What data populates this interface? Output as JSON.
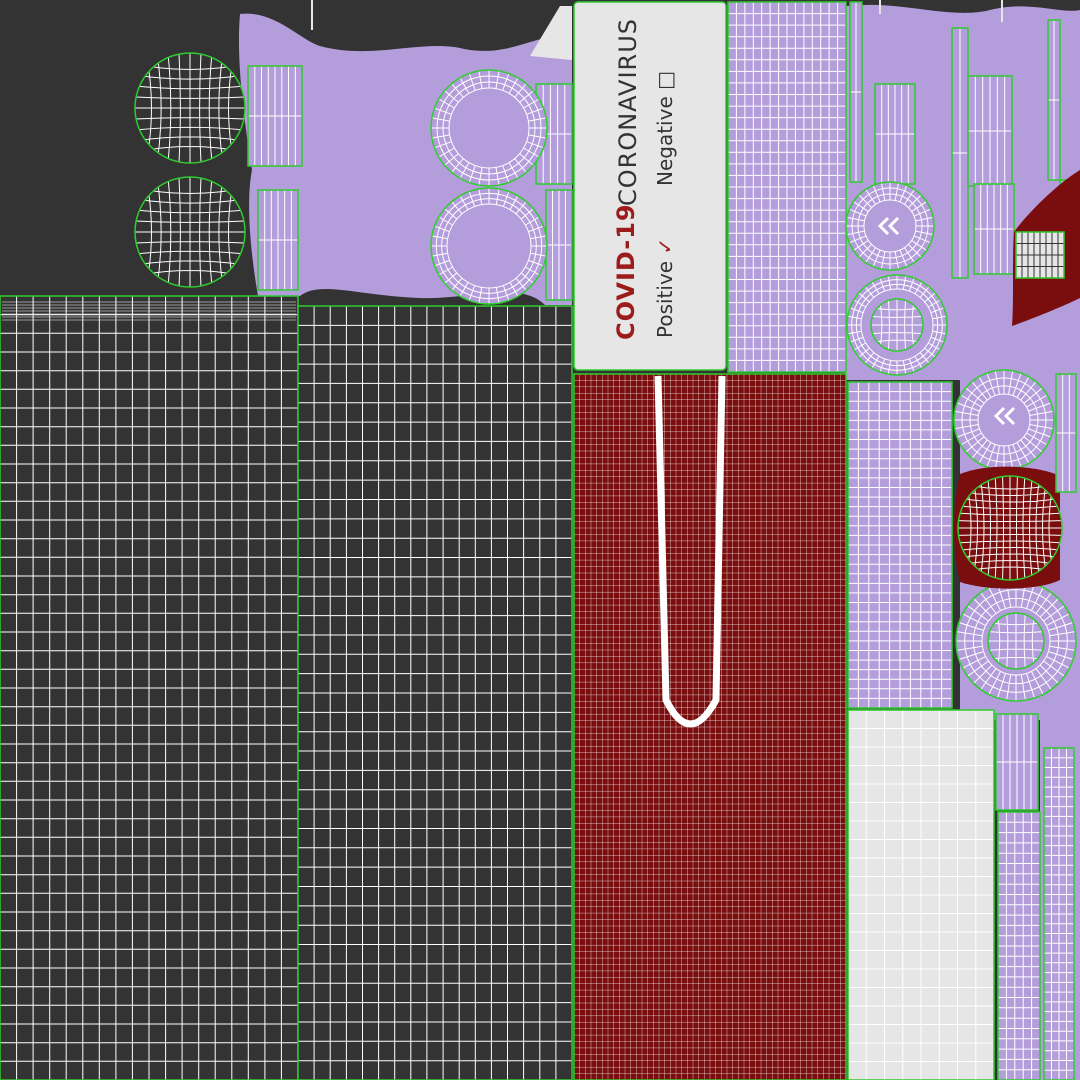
{
  "texture": {
    "colors": {
      "background": "#333333",
      "wire_white": "#ffffff",
      "island_border": "#2ecc2e",
      "purple": "#b39ddb",
      "light_gray": "#e6e6e6",
      "dark_red": "#7a0d0d",
      "red_text": "#9c1c1c",
      "dark_text": "#333333"
    }
  },
  "label": {
    "brand": "COVID-19",
    "title": "CORONAVIRUS",
    "positive_label": "Positive",
    "positive_mark": "✓",
    "negative_label": "Negative",
    "negative_mark": "□"
  }
}
